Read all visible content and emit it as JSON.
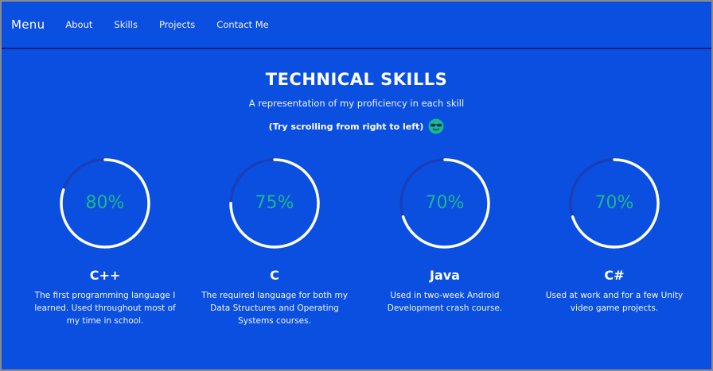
{
  "navbar": {
    "brand": "Menu",
    "links": [
      "About",
      "Skills",
      "Projects",
      "Contact Me"
    ]
  },
  "section": {
    "title": "TECHNICAL SKILLS",
    "subtitle": "A representation of my proficiency in each skill",
    "hint": "(Try scrolling from right to left)",
    "hint_icon": "sunglasses-emoji-icon"
  },
  "colors": {
    "background": "#0b4fe0",
    "ring_track": "#1a3fb8",
    "ring_fill": "#ffffff",
    "percent_text": "#19b98d",
    "emoji": "#19b98d"
  },
  "skills": [
    {
      "name": "C++",
      "percent_label": "80%",
      "percent": 80,
      "description": "The first programming language I learned. Used throughout most of my time in school."
    },
    {
      "name": "C",
      "percent_label": "75%",
      "percent": 75,
      "description": "The required language for both my Data Structures and Operating Systems courses."
    },
    {
      "name": "Java",
      "percent_label": "70%",
      "percent": 70,
      "description": "Used in two-week Android Development crash course."
    },
    {
      "name": "C#",
      "percent_label": "70%",
      "percent": 70,
      "description": "Used at work and for a few Unity video game projects."
    }
  ]
}
